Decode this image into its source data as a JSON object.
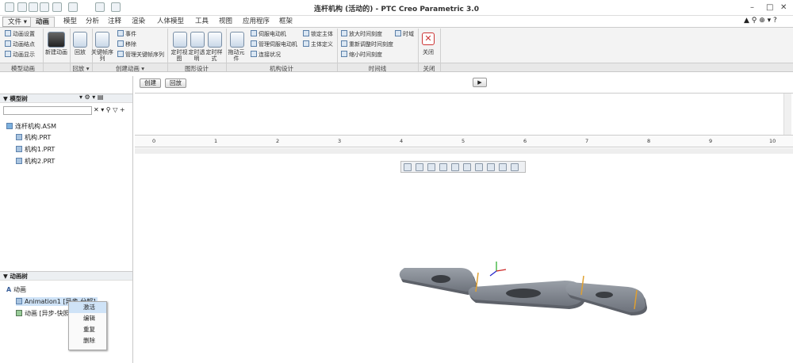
{
  "window": {
    "title": "连杆机构 (活动的) - PTC Creo Parametric 3.0"
  },
  "tabs": [
    {
      "label": "文件 ▾"
    },
    {
      "label": "动画"
    },
    {
      "label": "模型"
    },
    {
      "label": "分析"
    },
    {
      "label": "注释"
    },
    {
      "label": "渲染"
    },
    {
      "label": "人体模型"
    },
    {
      "label": "工具"
    },
    {
      "label": "视图"
    },
    {
      "label": "应用程序"
    },
    {
      "label": "框架"
    }
  ],
  "ribbon": {
    "model_anim": {
      "items": [
        "动画设置",
        "动画结点",
        "动画显示"
      ],
      "group": "模型动画"
    },
    "new_anim": {
      "label": "新建动画"
    },
    "playback": {
      "label": "回放",
      "group": "回放 ▾"
    },
    "keyframe": {
      "label": "关键帧序列"
    },
    "create": {
      "items": [
        "事件",
        "移除",
        "管理关键帧序列"
      ],
      "group": "创建动画 ▾"
    },
    "graphics": {
      "btns": [
        "定时视图",
        "定时透明",
        "定时样式"
      ],
      "group": "图形设计"
    },
    "drag": {
      "label": "拖动元件"
    },
    "mech": {
      "items": [
        "伺服电动机",
        "管理伺服电动机",
        "连接状况"
      ],
      "items2": [
        "锁定主体",
        "主体定义"
      ],
      "group": "机构设计"
    },
    "timeline": {
      "items": [
        "放大时间刻度",
        "重新调整时间刻度",
        "缩小时间刻度"
      ],
      "extra": "时域",
      "group": "时间线"
    },
    "close": {
      "label": "关闭",
      "group": "关闭"
    }
  },
  "model_tree": {
    "header": "模型树",
    "root": "连杆机构.ASM",
    "parts": [
      "机构.PRT",
      "机构1.PRT",
      "机构2.PRT"
    ]
  },
  "anim_tree": {
    "header": "动画树",
    "root": "动画",
    "items": [
      "Animation1 [异步-分解]",
      "动画 [异步-快照]"
    ]
  },
  "context_menu": [
    "激活",
    "编辑",
    "重复",
    "删除"
  ],
  "timeline": {
    "create_btn": "创建",
    "back_btn": "回放",
    "ticks": [
      "0",
      "1",
      "2",
      "3",
      "4",
      "5",
      "6",
      "7",
      "8",
      "9",
      "10"
    ]
  },
  "colors": {
    "part": "#7a7f88",
    "selection": "#cfe3f7"
  }
}
